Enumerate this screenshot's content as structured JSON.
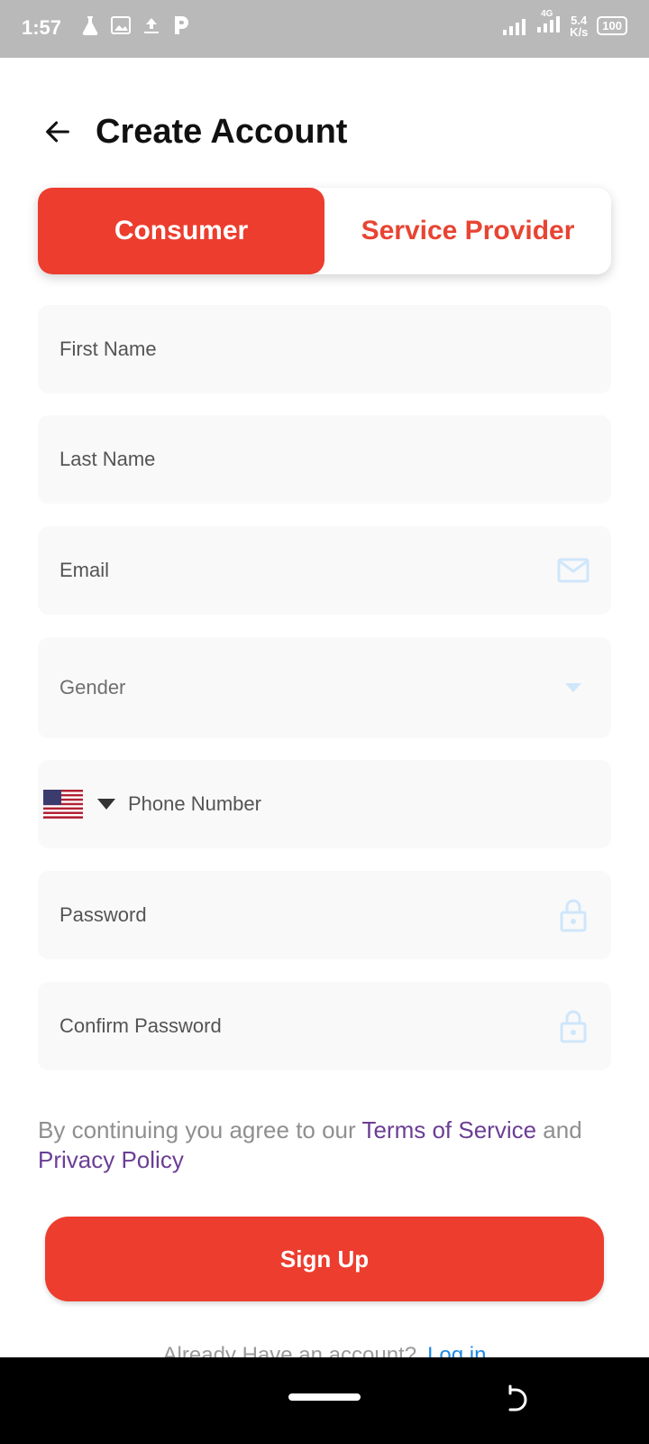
{
  "status_bar": {
    "time": "1:57",
    "net_label": "4G",
    "net_speed_value": "5.4",
    "net_speed_unit": "K/s",
    "battery": "100"
  },
  "header": {
    "title": "Create Account"
  },
  "tabs": {
    "consumer": "Consumer",
    "service_provider": "Service Provider",
    "active": "consumer"
  },
  "form": {
    "first_name": "First Name",
    "last_name": "Last Name",
    "email": "Email",
    "gender": "Gender",
    "phone": "Phone Number",
    "password": "Password",
    "confirm_password": "Confirm Password"
  },
  "terms": {
    "prefix": "By continuing you agree to our",
    "tos": "Terms of Service",
    "and": "and",
    "privacy": "Privacy Policy"
  },
  "signup_label": "Sign Up",
  "login_prompt": {
    "text": "Already Have an account?",
    "link": "Log in"
  },
  "colors": {
    "accent": "#ec3d2e",
    "link_purple": "#6b3e94",
    "field_bg": "#f9f9f9",
    "icon_blue": "#cfe6fb"
  }
}
